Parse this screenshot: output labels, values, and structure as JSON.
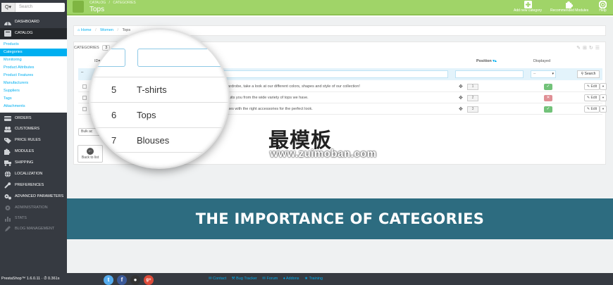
{
  "sidebar": {
    "search_dropdown": "Q▾",
    "search_placeholder": "Search",
    "items": {
      "dashboard": "Dashboard",
      "catalog": "Catalog",
      "orders": "Orders",
      "customers": "Customers",
      "price_rules": "Price Rules",
      "modules": "Modules",
      "shipping": "Shipping",
      "localization": "Localization",
      "preferences": "Preferences",
      "advanced": "Advanced Parameters",
      "administration": "Administration",
      "stats": "Stats",
      "blog": "Blog Management"
    },
    "catalog_sub": [
      "Products",
      "Categories",
      "Monitoring",
      "Product Attributes",
      "Product Features",
      "Manufacturers",
      "Suppliers",
      "Tags",
      "Attachments"
    ]
  },
  "header": {
    "crumb_root": "CATALOG",
    "crumb_sep": "/",
    "crumb_section": "CATEGORIES",
    "title": "Tops",
    "add_label": "Add new category",
    "recommended_label": "Recommended Modules",
    "help_label": "Help"
  },
  "breadcrumb": {
    "home": "Home",
    "women": "Women",
    "tops": "Tops"
  },
  "panel": {
    "title": "CATEGORIES",
    "count": "3",
    "col_id": "ID",
    "col_desc_partial": "ption",
    "col_position": "Position",
    "col_displayed": "Displayed",
    "filter_select": "--",
    "search_button": "Search",
    "bulk_label": "Bulk ac",
    "back_label": "Back to list"
  },
  "rows": [
    {
      "desc": "of your wardrobe, take a look at our different colors, shapes and style of our collection!",
      "position": "1",
      "displayed": "on",
      "edit": "Edit"
    },
    {
      "desc": "hat best suits you from the wide variety of tops we have.",
      "position": "2",
      "displayed": "off",
      "edit": "Edit"
    },
    {
      "desc": "rites blouses with the right accessories for the perfect look.",
      "position": "3",
      "displayed": "on",
      "edit": "Edit"
    }
  ],
  "magnifier_rows": [
    {
      "id": "5",
      "name": "T-shirts"
    },
    {
      "id": "6",
      "name": "Tops"
    },
    {
      "id": "7",
      "name": "Blouses"
    }
  ],
  "watermark": {
    "cn": "最模板",
    "url": "www.zuimoban.com"
  },
  "banner": {
    "text": "THE IMPORTANCE OF CATEGORIES"
  },
  "footer": {
    "version": "PrestaShop™ 1.6.0.11 · ⏱ 0.361s",
    "links": [
      "Contact",
      "Bug Tracker",
      "Forum",
      "Addons",
      "Training"
    ],
    "social": [
      "t",
      "f",
      "gh",
      "g+"
    ]
  },
  "colors": {
    "header_green": "#a0d468",
    "sidebar": "#363a41",
    "accent_blue": "#00aff0",
    "banner": "#2d6c80",
    "status_on": "#72c279",
    "status_off": "#e08f95"
  }
}
